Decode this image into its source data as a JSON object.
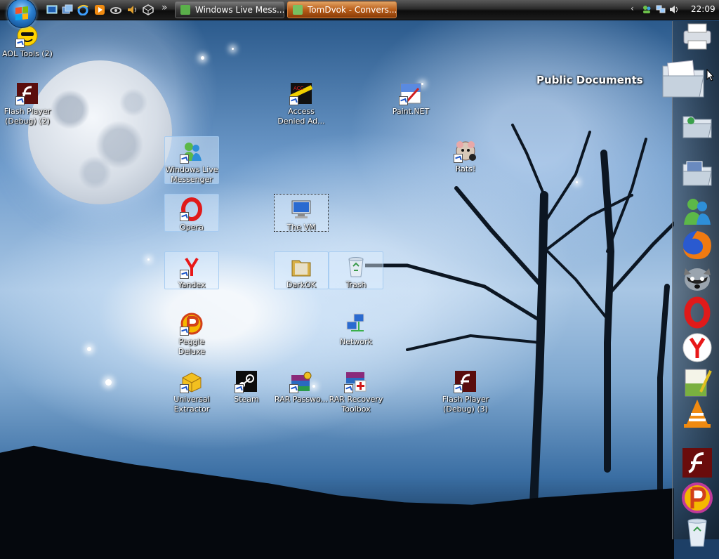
{
  "taskbar": {
    "buttons": [
      {
        "label": "Windows Live Mess...",
        "active": false
      },
      {
        "label": "TomDvok - Convers...",
        "active": true
      }
    ],
    "quick_launch": [
      "show-desktop-icon",
      "switch-windows-icon",
      "internet-explorer-icon",
      "media-player-icon",
      "network-wifi-icon",
      "volume-icon",
      "cube-icon"
    ],
    "overflow": "»",
    "tray": {
      "chevron": "‹",
      "clock": "22:09"
    }
  },
  "desktop": {
    "icons": [
      {
        "label": "AOL Tools (2)",
        "icon": "aol-smiley-icon"
      },
      {
        "label": "Flash Player (Debug) (2)",
        "icon": "flash-player-icon"
      },
      {
        "label": "Windows Live Messenger",
        "icon": "messenger-icon"
      },
      {
        "label": "Opera",
        "icon": "opera-icon"
      },
      {
        "label": "Yandex",
        "icon": "yandex-icon"
      },
      {
        "label": "Peggle Deluxe",
        "icon": "peggle-icon"
      },
      {
        "label": "Universal Extractor",
        "icon": "extractor-icon"
      },
      {
        "label": "Steam",
        "icon": "steam-icon"
      },
      {
        "label": "RAR Passwo...",
        "icon": "rar-password-icon"
      },
      {
        "label": "RAR Recovery Toolbox",
        "icon": "rar-recovery-icon"
      },
      {
        "label": "Access Denied Ad...",
        "icon": "access-denied-icon"
      },
      {
        "label": "The VM",
        "icon": "computer-icon"
      },
      {
        "label": "DarkOK",
        "icon": "folder-icon"
      },
      {
        "label": "Trash",
        "icon": "recycle-bin-icon"
      },
      {
        "label": "Network",
        "icon": "network-icon"
      },
      {
        "label": "Paint.NET",
        "icon": "paint-net-icon"
      },
      {
        "label": "Rats!",
        "icon": "rats-icon"
      },
      {
        "label": "Flash Player (Debug) (3)",
        "icon": "flash-player-icon"
      }
    ]
  },
  "dock": {
    "hover_label": "Public Documents",
    "items": [
      "printer-icon",
      "documents-folder-icon",
      "music-folder-icon",
      "pictures-folder-icon",
      "messenger-icon",
      "firefox-icon",
      "raccoon-icon",
      "opera-icon",
      "yandex-icon",
      "notepad-icon",
      "vlc-icon",
      "flash-icon",
      "peggle-icon",
      "recycle-bin-icon"
    ]
  },
  "colors": {
    "active_button": "#b85c18",
    "taskbar": "#1c1c1c",
    "accent": "#2a7fd0"
  }
}
